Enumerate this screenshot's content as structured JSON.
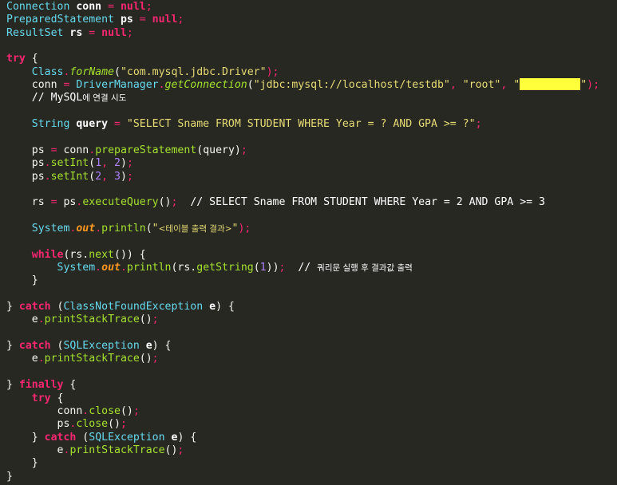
{
  "editor": {
    "theme": "monokai",
    "colors": {
      "background": "#272822",
      "type": "#66d9ef",
      "keyword": "#f92672",
      "string": "#e6db74",
      "method": "#a6e22e",
      "number": "#ae81ff",
      "field": "#fd971f",
      "plain": "#f8f8f2",
      "redaction": "#ffff3c"
    },
    "lines": [
      {
        "tokens": [
          {
            "t": "Connection",
            "c": "type"
          },
          {
            "t": " "
          },
          {
            "t": "conn",
            "c": "var"
          },
          {
            "t": " = ",
            "c": "op"
          },
          {
            "t": "null",
            "c": "kw"
          },
          {
            "t": ";",
            "c": "op"
          }
        ]
      },
      {
        "tokens": [
          {
            "t": "PreparedStatement",
            "c": "type"
          },
          {
            "t": " "
          },
          {
            "t": "ps",
            "c": "var"
          },
          {
            "t": " = ",
            "c": "op"
          },
          {
            "t": "null",
            "c": "kw"
          },
          {
            "t": ";",
            "c": "op"
          }
        ]
      },
      {
        "tokens": [
          {
            "t": "ResultSet",
            "c": "type"
          },
          {
            "t": " "
          },
          {
            "t": "rs",
            "c": "var"
          },
          {
            "t": " = ",
            "c": "op"
          },
          {
            "t": "null",
            "c": "kw"
          },
          {
            "t": ";",
            "c": "op"
          }
        ]
      },
      {
        "tokens": []
      },
      {
        "tokens": [
          {
            "t": "try",
            "c": "kw"
          },
          {
            "t": " {",
            "c": "plain"
          }
        ]
      },
      {
        "tokens": [
          {
            "t": "    "
          },
          {
            "t": "Class",
            "c": "type"
          },
          {
            "t": ".",
            "c": "op"
          },
          {
            "t": "forName",
            "c": "fn"
          },
          {
            "t": "(",
            "c": "plain"
          },
          {
            "t": "\"com.mysql.jdbc.Driver\"",
            "c": "str"
          },
          {
            "t": ");",
            "c": "op"
          }
        ]
      },
      {
        "tokens": [
          {
            "t": "    "
          },
          {
            "t": "conn",
            "c": "plain"
          },
          {
            "t": " = ",
            "c": "op"
          },
          {
            "t": "DriverManager",
            "c": "type"
          },
          {
            "t": ".",
            "c": "op"
          },
          {
            "t": "getConnection",
            "c": "fn"
          },
          {
            "t": "(",
            "c": "plain"
          },
          {
            "t": "\"jdbc:mysql://localhost/testdb\"",
            "c": "str"
          },
          {
            "t": ", ",
            "c": "op"
          },
          {
            "t": "\"root\"",
            "c": "str"
          },
          {
            "t": ", ",
            "c": "op"
          },
          {
            "t": "\"",
            "c": "str"
          },
          {
            "t": "",
            "c": "redacted"
          },
          {
            "t": "\"",
            "c": "str"
          },
          {
            "t": ");",
            "c": "op"
          }
        ]
      },
      {
        "tokens": [
          {
            "t": "    "
          },
          {
            "t": "// MySQL",
            "c": "cmt"
          },
          {
            "t": "에 연결 시도",
            "c": "cmt-kor"
          }
        ]
      },
      {
        "tokens": []
      },
      {
        "tokens": [
          {
            "t": "    "
          },
          {
            "t": "String",
            "c": "type"
          },
          {
            "t": " "
          },
          {
            "t": "query",
            "c": "var"
          },
          {
            "t": " = ",
            "c": "op"
          },
          {
            "t": "\"SELECT Sname FROM STUDENT WHERE Year = ? AND GPA >= ?\"",
            "c": "str"
          },
          {
            "t": ";",
            "c": "op"
          }
        ]
      },
      {
        "tokens": []
      },
      {
        "tokens": [
          {
            "t": "    "
          },
          {
            "t": "ps",
            "c": "plain"
          },
          {
            "t": " = ",
            "c": "op"
          },
          {
            "t": "conn",
            "c": "plain"
          },
          {
            "t": ".",
            "c": "op"
          },
          {
            "t": "prepareStatement",
            "c": "meth"
          },
          {
            "t": "(query)",
            "c": "plain"
          },
          {
            "t": ";",
            "c": "op"
          }
        ]
      },
      {
        "tokens": [
          {
            "t": "    "
          },
          {
            "t": "ps",
            "c": "plain"
          },
          {
            "t": ".",
            "c": "op"
          },
          {
            "t": "setInt",
            "c": "meth"
          },
          {
            "t": "(",
            "c": "plain"
          },
          {
            "t": "1",
            "c": "num"
          },
          {
            "t": ", ",
            "c": "op"
          },
          {
            "t": "2",
            "c": "num"
          },
          {
            "t": ")",
            "c": "plain"
          },
          {
            "t": ";",
            "c": "op"
          }
        ]
      },
      {
        "tokens": [
          {
            "t": "    "
          },
          {
            "t": "ps",
            "c": "plain"
          },
          {
            "t": ".",
            "c": "op"
          },
          {
            "t": "setInt",
            "c": "meth"
          },
          {
            "t": "(",
            "c": "plain"
          },
          {
            "t": "2",
            "c": "num"
          },
          {
            "t": ", ",
            "c": "op"
          },
          {
            "t": "3",
            "c": "num"
          },
          {
            "t": ")",
            "c": "plain"
          },
          {
            "t": ";",
            "c": "op"
          }
        ]
      },
      {
        "tokens": []
      },
      {
        "tokens": [
          {
            "t": "    "
          },
          {
            "t": "rs",
            "c": "plain"
          },
          {
            "t": " = ",
            "c": "op"
          },
          {
            "t": "ps",
            "c": "plain"
          },
          {
            "t": ".",
            "c": "op"
          },
          {
            "t": "executeQuery",
            "c": "meth"
          },
          {
            "t": "()",
            "c": "plain"
          },
          {
            "t": ";",
            "c": "op"
          },
          {
            "t": "  // SELECT Sname FROM STUDENT WHERE Year = 2 AND GPA >= 3",
            "c": "cmt"
          }
        ]
      },
      {
        "tokens": []
      },
      {
        "tokens": [
          {
            "t": "    "
          },
          {
            "t": "System",
            "c": "type"
          },
          {
            "t": ".",
            "c": "op"
          },
          {
            "t": "out",
            "c": "field"
          },
          {
            "t": ".",
            "c": "op"
          },
          {
            "t": "println",
            "c": "meth"
          },
          {
            "t": "(",
            "c": "plain"
          },
          {
            "t": "\"",
            "c": "str"
          },
          {
            "t": "<테이블 출력 결과>",
            "c": "str-kor"
          },
          {
            "t": "\"",
            "c": "str"
          },
          {
            "t": ");",
            "c": "op"
          }
        ]
      },
      {
        "tokens": []
      },
      {
        "tokens": [
          {
            "t": "    "
          },
          {
            "t": "while",
            "c": "kw"
          },
          {
            "t": "(rs.",
            "c": "plain"
          },
          {
            "t": "next",
            "c": "meth"
          },
          {
            "t": "()) {",
            "c": "plain"
          }
        ]
      },
      {
        "tokens": [
          {
            "t": "        "
          },
          {
            "t": "System",
            "c": "type"
          },
          {
            "t": ".",
            "c": "op"
          },
          {
            "t": "out",
            "c": "field"
          },
          {
            "t": ".",
            "c": "op"
          },
          {
            "t": "println",
            "c": "meth"
          },
          {
            "t": "(rs.",
            "c": "plain"
          },
          {
            "t": "getString",
            "c": "meth"
          },
          {
            "t": "(",
            "c": "plain"
          },
          {
            "t": "1",
            "c": "num"
          },
          {
            "t": "))",
            "c": "plain"
          },
          {
            "t": ";",
            "c": "op"
          },
          {
            "t": "  // ",
            "c": "cmt"
          },
          {
            "t": "쿼리문 실행 후 결과값 출력",
            "c": "cmt-kor"
          }
        ]
      },
      {
        "tokens": [
          {
            "t": "    "
          },
          {
            "t": "}",
            "c": "plain"
          }
        ]
      },
      {
        "tokens": []
      },
      {
        "tokens": [
          {
            "t": "} ",
            "c": "plain"
          },
          {
            "t": "catch",
            "c": "kw"
          },
          {
            "t": " (",
            "c": "plain"
          },
          {
            "t": "ClassNotFoundException",
            "c": "type"
          },
          {
            "t": " "
          },
          {
            "t": "e",
            "c": "var"
          },
          {
            "t": ") {",
            "c": "plain"
          }
        ]
      },
      {
        "tokens": [
          {
            "t": "    "
          },
          {
            "t": "e",
            "c": "plain"
          },
          {
            "t": ".",
            "c": "op"
          },
          {
            "t": "printStackTrace",
            "c": "meth"
          },
          {
            "t": "()",
            "c": "plain"
          },
          {
            "t": ";",
            "c": "op"
          }
        ]
      },
      {
        "tokens": []
      },
      {
        "tokens": [
          {
            "t": "} ",
            "c": "plain"
          },
          {
            "t": "catch",
            "c": "kw"
          },
          {
            "t": " (",
            "c": "plain"
          },
          {
            "t": "SQLException",
            "c": "type"
          },
          {
            "t": " "
          },
          {
            "t": "e",
            "c": "var"
          },
          {
            "t": ") {",
            "c": "plain"
          }
        ]
      },
      {
        "tokens": [
          {
            "t": "    "
          },
          {
            "t": "e",
            "c": "plain"
          },
          {
            "t": ".",
            "c": "op"
          },
          {
            "t": "printStackTrace",
            "c": "meth"
          },
          {
            "t": "()",
            "c": "plain"
          },
          {
            "t": ";",
            "c": "op"
          }
        ]
      },
      {
        "tokens": []
      },
      {
        "tokens": [
          {
            "t": "} ",
            "c": "plain"
          },
          {
            "t": "finally",
            "c": "kw"
          },
          {
            "t": " {",
            "c": "plain"
          }
        ]
      },
      {
        "tokens": [
          {
            "t": "    "
          },
          {
            "t": "try",
            "c": "kw"
          },
          {
            "t": " {",
            "c": "plain"
          }
        ]
      },
      {
        "tokens": [
          {
            "t": "        "
          },
          {
            "t": "conn",
            "c": "plain"
          },
          {
            "t": ".",
            "c": "op"
          },
          {
            "t": "close",
            "c": "meth"
          },
          {
            "t": "()",
            "c": "plain"
          },
          {
            "t": ";",
            "c": "op"
          }
        ]
      },
      {
        "tokens": [
          {
            "t": "        "
          },
          {
            "t": "ps",
            "c": "plain"
          },
          {
            "t": ".",
            "c": "op"
          },
          {
            "t": "close",
            "c": "meth"
          },
          {
            "t": "()",
            "c": "plain"
          },
          {
            "t": ";",
            "c": "op"
          }
        ]
      },
      {
        "tokens": [
          {
            "t": "    "
          },
          {
            "t": "} ",
            "c": "plain"
          },
          {
            "t": "catch",
            "c": "kw"
          },
          {
            "t": " (",
            "c": "plain"
          },
          {
            "t": "SQLException",
            "c": "type"
          },
          {
            "t": " "
          },
          {
            "t": "e",
            "c": "var"
          },
          {
            "t": ") {",
            "c": "plain"
          }
        ]
      },
      {
        "tokens": [
          {
            "t": "        "
          },
          {
            "t": "e",
            "c": "plain"
          },
          {
            "t": ".",
            "c": "op"
          },
          {
            "t": "printStackTrace",
            "c": "meth"
          },
          {
            "t": "()",
            "c": "plain"
          },
          {
            "t": ";",
            "c": "op"
          }
        ]
      },
      {
        "tokens": [
          {
            "t": "    "
          },
          {
            "t": "}",
            "c": "plain"
          }
        ]
      },
      {
        "tokens": [
          {
            "t": "}",
            "c": "plain"
          }
        ]
      }
    ]
  }
}
